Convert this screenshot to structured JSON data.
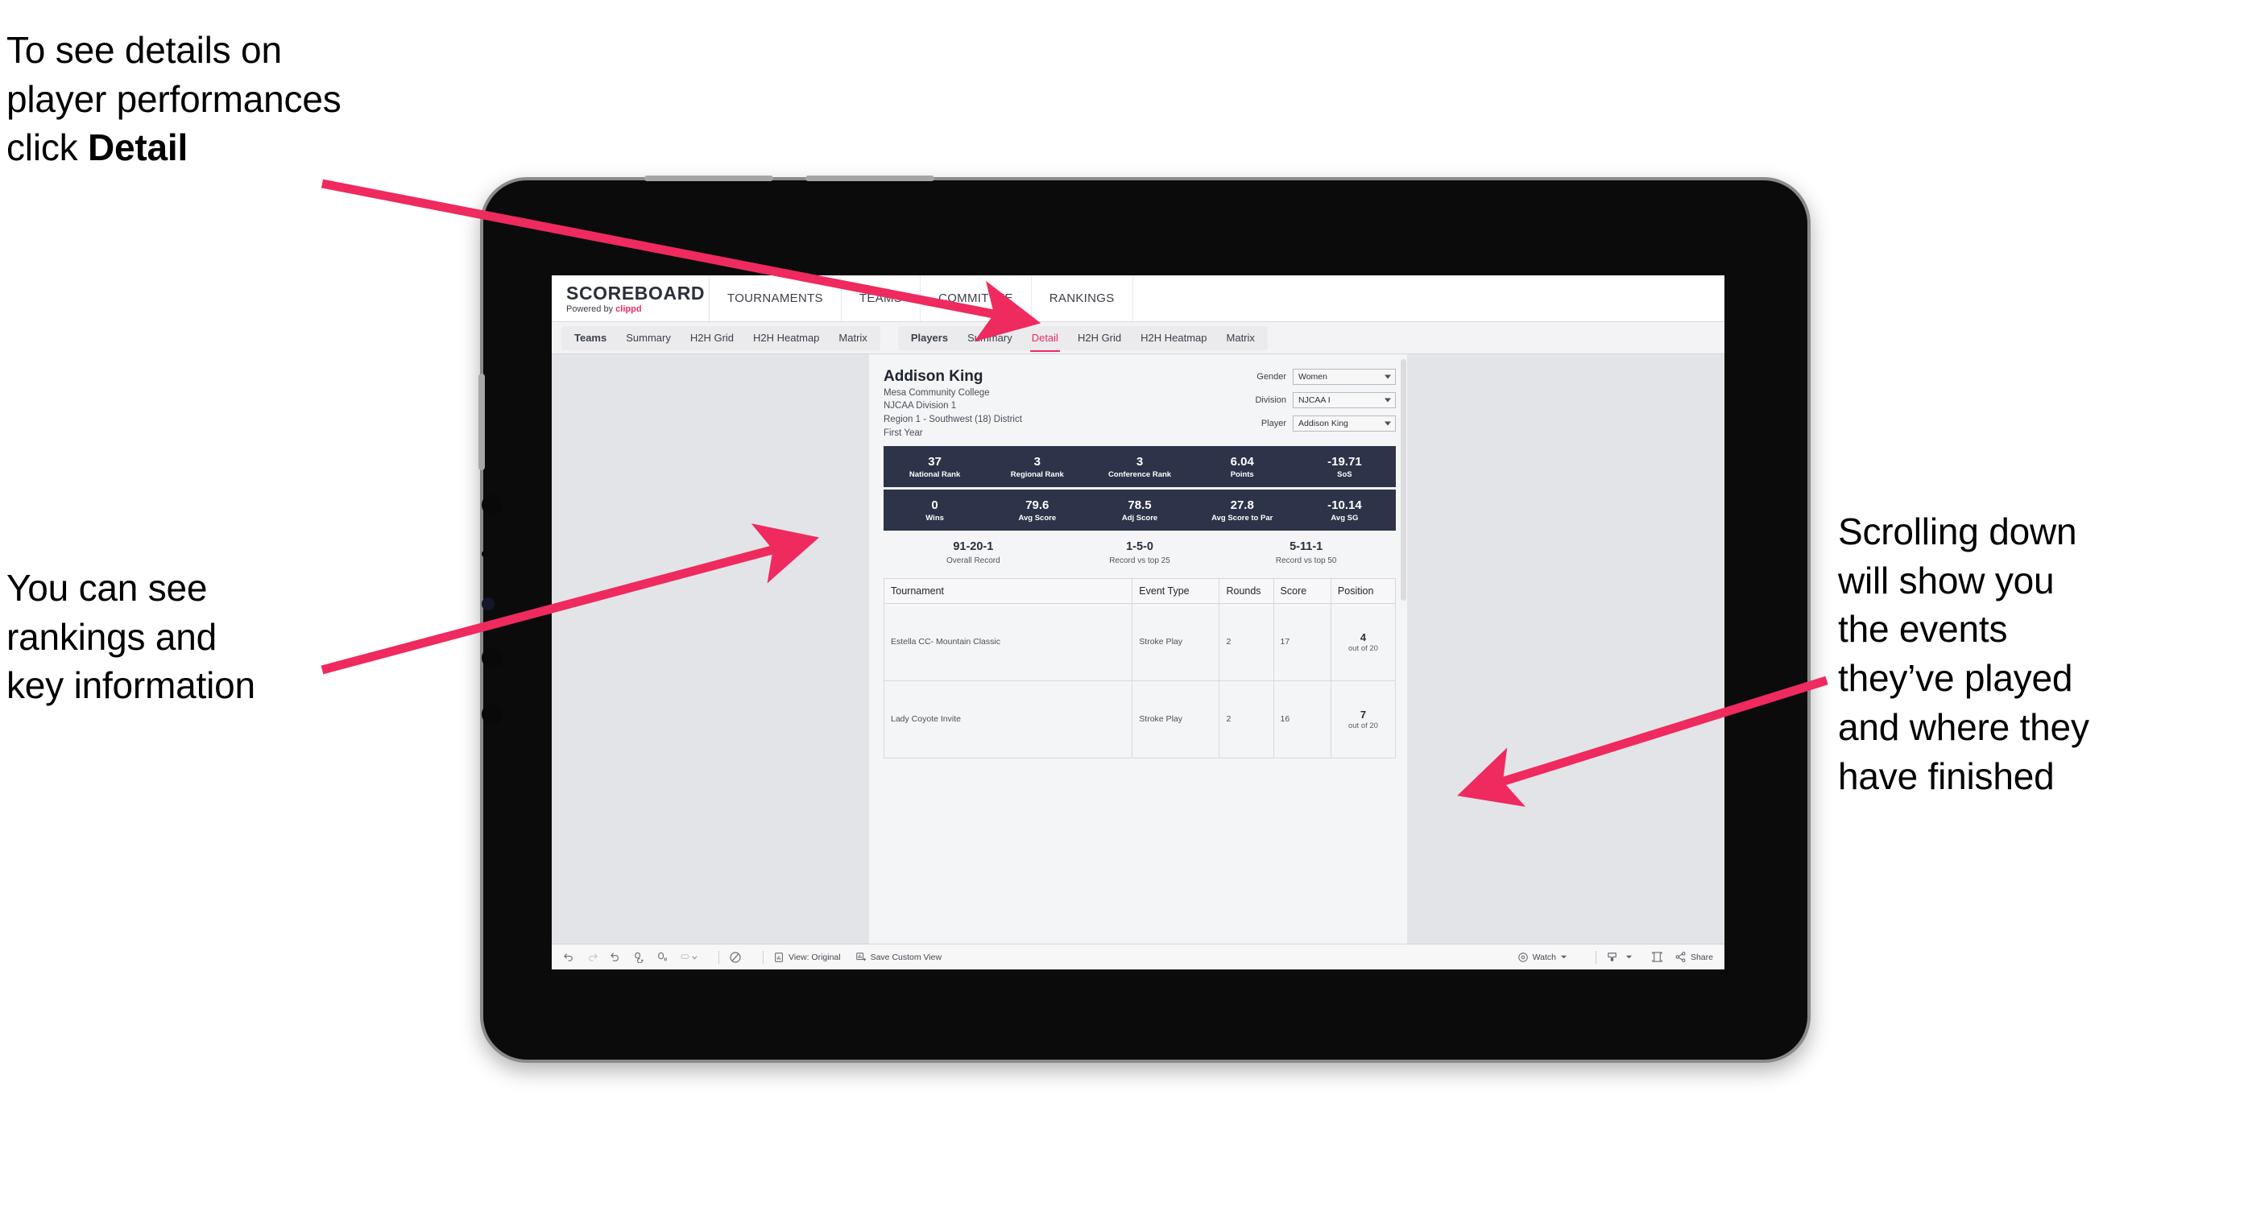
{
  "annotations": {
    "top_left": {
      "line1": "To see details on",
      "line2": "player performances",
      "line3_prefix": "click ",
      "line3_bold": "Detail"
    },
    "mid_left": {
      "line1": "You can see",
      "line2": "rankings and",
      "line3": "key information"
    },
    "right": {
      "line1": "Scrolling down",
      "line2": "will show you",
      "line3": "the events",
      "line4": "they’ve played",
      "line5": "and where they",
      "line6": "have finished"
    },
    "arrow_color": "#ee2a5f"
  },
  "app": {
    "brand": {
      "title": "SCOREBOARD",
      "powered_prefix": "Powered by ",
      "powered_brand": "clippd",
      "brand_color": "#ef2b62"
    },
    "top_nav": [
      {
        "label": "TOURNAMENTS"
      },
      {
        "label": "TEAMS"
      },
      {
        "label": "COMMITTEE"
      },
      {
        "label": "RANKINGS"
      }
    ],
    "sub_nav": {
      "group_teams": [
        {
          "label": "Teams",
          "lead": true,
          "active": false
        },
        {
          "label": "Summary",
          "lead": false,
          "active": false
        },
        {
          "label": "H2H Grid",
          "lead": false,
          "active": false
        },
        {
          "label": "H2H Heatmap",
          "lead": false,
          "active": false
        },
        {
          "label": "Matrix",
          "lead": false,
          "active": false
        }
      ],
      "group_players": [
        {
          "label": "Players",
          "lead": true,
          "active": false
        },
        {
          "label": "Summary",
          "lead": false,
          "active": false
        },
        {
          "label": "Detail",
          "lead": false,
          "active": true
        },
        {
          "label": "H2H Grid",
          "lead": false,
          "active": false
        },
        {
          "label": "H2H Heatmap",
          "lead": false,
          "active": false
        },
        {
          "label": "Matrix",
          "lead": false,
          "active": false
        }
      ],
      "active_color": "#ef2b62"
    }
  },
  "player": {
    "name": "Addison King",
    "school": "Mesa Community College",
    "division": "NJCAA Division 1",
    "region": "Region 1 - Southwest (18) District",
    "year": "First Year"
  },
  "filters": [
    {
      "label": "Gender",
      "value": "Women"
    },
    {
      "label": "Division",
      "value": "NJCAA I"
    },
    {
      "label": "Player",
      "value": "Addison King"
    }
  ],
  "stats_row_1": [
    {
      "value": "37",
      "label": "National Rank"
    },
    {
      "value": "3",
      "label": "Regional Rank"
    },
    {
      "value": "3",
      "label": "Conference Rank"
    },
    {
      "value": "6.04",
      "label": "Points"
    },
    {
      "value": "-19.71",
      "label": "SoS"
    }
  ],
  "stats_row_2": [
    {
      "value": "0",
      "label": "Wins"
    },
    {
      "value": "79.6",
      "label": "Avg Score"
    },
    {
      "value": "78.5",
      "label": "Adj Score"
    },
    {
      "value": "27.8",
      "label": "Avg Score to Par"
    },
    {
      "value": "-10.14",
      "label": "Avg SG"
    }
  ],
  "records": [
    {
      "value": "91-20-1",
      "label": "Overall Record"
    },
    {
      "value": "1-5-0",
      "label": "Record vs top 25"
    },
    {
      "value": "5-11-1",
      "label": "Record vs top 50"
    }
  ],
  "events_table": {
    "headers": [
      "Tournament",
      "Event Type",
      "Rounds",
      "Score",
      "Position"
    ],
    "rows": [
      {
        "tournament": "Estella CC- Mountain Classic",
        "event_type": "Stroke Play",
        "rounds": "2",
        "score": "17",
        "position": "4",
        "position_of": "out of 20"
      },
      {
        "tournament": "Lady Coyote Invite",
        "event_type": "Stroke Play",
        "rounds": "2",
        "score": "16",
        "position": "7",
        "position_of": "out of 20"
      }
    ]
  },
  "bottom_toolbar": {
    "view_label": "View: Original",
    "save_label": "Save Custom View",
    "watch_label": "Watch",
    "share_label": "Share"
  },
  "stat_bar_color": "#2d3348"
}
